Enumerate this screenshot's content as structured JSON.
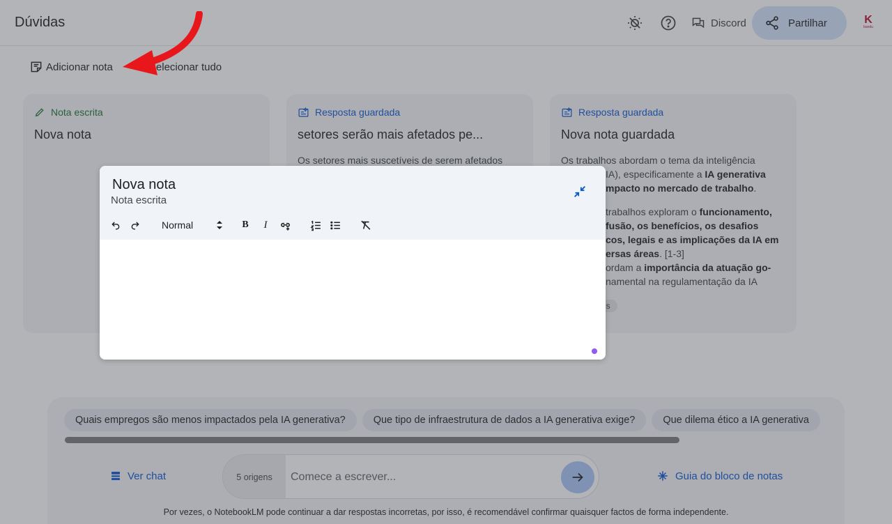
{
  "header": {
    "title": "Dúvidas",
    "discord_label": "Discord",
    "share_label": "Partilhar",
    "avatar_text": "K",
    "avatar_brand": "bandu"
  },
  "actions": {
    "add_note": "Adicionar nota",
    "select_all": "Selecionar tudo"
  },
  "cards": [
    {
      "tag": "Nota escrita",
      "title": "Nova nota",
      "body": ""
    },
    {
      "tag": "Resposta guardada",
      "title": "setores serão mais afetados pe...",
      "body": "Os setores mais suscetíveis de serem afetados"
    },
    {
      "tag": "Resposta guardada",
      "title": "Nova nota guardada",
      "body1_a": "Os trabalhos abordam o tema da inteligência",
      "body1_b": "IA), especificamente a ",
      "body1_c": "IA generativa",
      "body1_d": "mpacto no mercado de trabalho",
      "body2_a": "trabalhos exploram o ",
      "body2_b": "funcionamento,",
      "body2_c": "fusão, os benefícios, os desafios",
      "body2_d": "cos, legais e as implicações da IA em",
      "body2_e": "ersas áreas",
      "body2_f": ". [1-3]",
      "body3_a": "ordam a ",
      "body3_b": "importância da atuação go-",
      "body3_c": "namental na regulamentação da IA",
      "chip": "es"
    }
  ],
  "suggestions": [
    "Quais empregos são menos impactados pela IA generativa?",
    "Que tipo de infraestrutura de dados a IA generativa exige?",
    "Que dilema ético a IA generativa"
  ],
  "chat": {
    "view_chat": "Ver chat",
    "sources": "5 origens",
    "placeholder": "Comece a escrever...",
    "guide": "Guia do bloco de notas",
    "disclaimer": "Por vezes, o NotebookLM pode continuar a dar respostas incorretas, por isso, é recomendável confirmar quaisquer factos de forma independente."
  },
  "editor": {
    "title": "Nova nota",
    "subtitle": "Nota escrita",
    "format": "Normal",
    "bold": "B",
    "italic": "I"
  },
  "colors": {
    "accent_blue": "#0b57d0",
    "note_green": "#187432",
    "annotation_arrow": "#e8171c",
    "resize_dot": "#8e5cf0"
  },
  "icons": [
    "brightness-icon",
    "help-icon",
    "discord-icon",
    "share-icon",
    "note-icon",
    "select-all-icon",
    "pencil-icon",
    "saved-response-icon",
    "chat-icon",
    "send-arrow-icon",
    "sparkle-icon",
    "collapse-icon",
    "undo-icon",
    "redo-icon",
    "link-icon",
    "numbered-list-icon",
    "bullet-list-icon",
    "clear-format-icon"
  ]
}
